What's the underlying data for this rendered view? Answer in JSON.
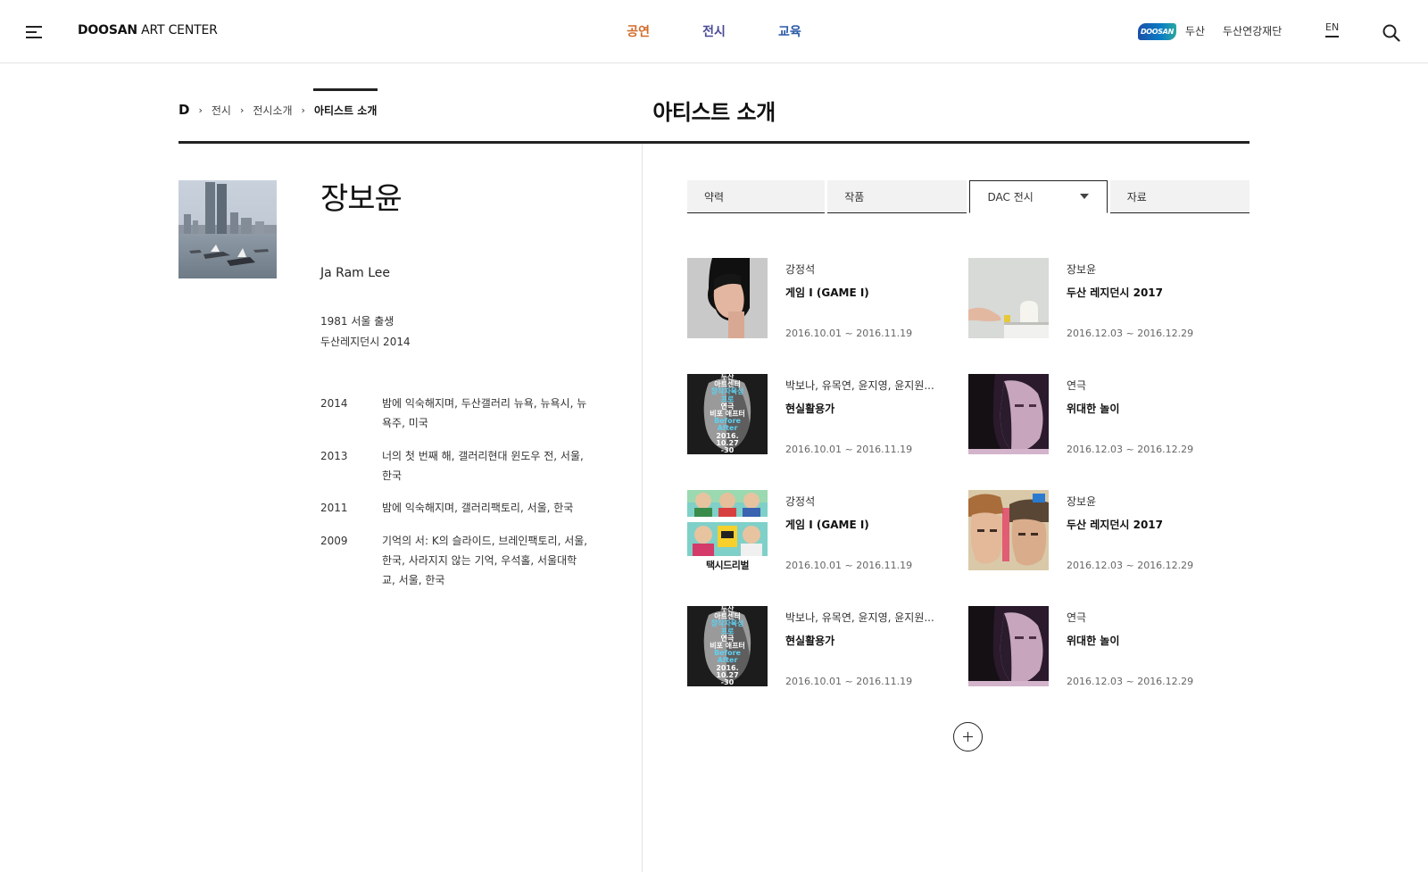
{
  "header": {
    "logo_bold": "DOOSAN",
    "logo_rest": " ART CENTER",
    "nav": [
      {
        "label": "공연",
        "color": "#d26b2a"
      },
      {
        "label": "전시",
        "color": "#4a4a95"
      },
      {
        "label": "교육",
        "color": "#2a5aa8"
      }
    ],
    "badge": "DOOSAN",
    "util_links": [
      "두산",
      "두산연강재단"
    ],
    "lang": "EN"
  },
  "breadcrumb": {
    "home": "D",
    "items": [
      "전시",
      "전시소개"
    ],
    "current": "아티스트 소개"
  },
  "page_title": "아티스트 소개",
  "artist": {
    "name_ko": "장보윤",
    "name_en": "Ja Ram Lee",
    "bio": [
      "1981 서울 출생",
      "두산레지던시 2014"
    ],
    "history": [
      {
        "year": "2014",
        "text": "밤에 익숙해지며, 두산갤러리 뉴욕, 뉴욕시, 뉴욕주, 미국"
      },
      {
        "year": "2013",
        "text": "너의 첫 번째 해, 갤러리현대 윈도우 전, 서울, 한국"
      },
      {
        "year": "2011",
        "text": "밤에 익숙해지며, 갤러리팩토리, 서울, 한국"
      },
      {
        "year": "2009",
        "text": "기억의 서: K의 슬라이드, 브레인팩토리, 서울, 한국, 사라지지 않는 기억, 우석홀, 서울대학교, 서울, 한국"
      }
    ]
  },
  "tabs": [
    {
      "label": "약력",
      "active": false
    },
    {
      "label": "작품",
      "active": false
    },
    {
      "label": "DAC 전시",
      "active": true
    },
    {
      "label": "자료",
      "active": false
    }
  ],
  "cards": [
    {
      "category": "강정석",
      "title": "게임 I (GAME I)",
      "date": "2016.10.01 ~ 2016.11.19",
      "thumb": "woman-profile"
    },
    {
      "category": "장보윤",
      "title": "두산 레지던시 2017",
      "date": "2016.12.03 ~ 2016.12.29",
      "thumb": "hand-object"
    },
    {
      "category": "박보나, 유목연, 윤지영, 윤지원...",
      "title": "현실활용가",
      "date": "2016.10.01 ~ 2016.11.19",
      "thumb": "poster-face"
    },
    {
      "category": "연극",
      "title": "위대한 놀이",
      "date": "2016.12.03 ~ 2016.12.29",
      "thumb": "poster-purple"
    },
    {
      "category": "강정석",
      "title": "게임 I (GAME I)",
      "date": "2016.10.01 ~ 2016.11.19",
      "thumb": "poster-taxi"
    },
    {
      "category": "장보윤",
      "title": "두산 레지던시 2017",
      "date": "2016.12.03 ~ 2016.12.29",
      "thumb": "poster-hats"
    },
    {
      "category": "박보나, 유목연, 윤지영, 윤지원...",
      "title": "현실활용가",
      "date": "2016.10.01 ~ 2016.11.19",
      "thumb": "poster-face"
    },
    {
      "category": "연극",
      "title": "위대한 놀이",
      "date": "2016.12.03 ~ 2016.12.29",
      "thumb": "poster-purple"
    }
  ],
  "poster_text": {
    "face_lines": [
      "두산",
      "아트센터",
      "창작자육성",
      "프로",
      "연극",
      "비포 애프터",
      "Before",
      "After",
      "2016.",
      "10.27",
      "-30"
    ],
    "taxi_title": "택시드리벌"
  }
}
